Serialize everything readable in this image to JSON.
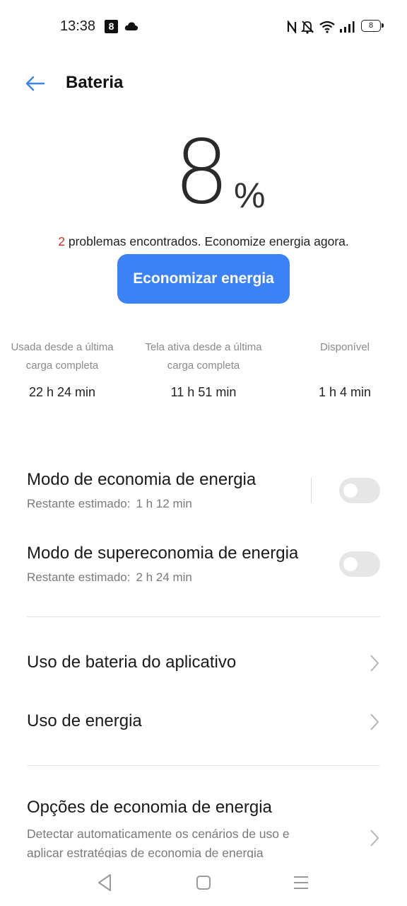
{
  "status_bar": {
    "time": "13:38",
    "badge": "8",
    "battery": "8",
    "icons": [
      "cloud-icon",
      "nfc-icon",
      "bell-off-icon",
      "wifi-icon",
      "signal-icon",
      "battery-icon"
    ]
  },
  "header": {
    "title": "Bateria",
    "back_icon": "arrow-left-icon",
    "accent": "#3b82f6"
  },
  "battery": {
    "percent": "8",
    "percent_sign": "%",
    "problems_count": "2",
    "problems_text": " problemas encontrados. Economize energia agora.",
    "save_button": "Economizar energia"
  },
  "stats": [
    {
      "label_line1": "Usada desde a última",
      "label_line2": "carga completa",
      "value": "22 h 24 min"
    },
    {
      "label_line1": "Tela ativa desde a última",
      "label_line2": "carga completa",
      "value": "11 h 51 min"
    },
    {
      "label_line1": "Disponível",
      "label_line2": "",
      "value": "1 h 4 min"
    }
  ],
  "modes": [
    {
      "title": "Modo de economia de energia",
      "sub_label": "Restante estimado:",
      "sub_value": "1 h 12 min",
      "enabled": false
    },
    {
      "title": "Modo de supereconomia de energia",
      "sub_label": "Restante estimado:",
      "sub_value": "2 h 24 min",
      "enabled": false
    }
  ],
  "nav_items": [
    {
      "title": "Uso de bateria do aplicativo"
    },
    {
      "title": "Uso de energia"
    }
  ],
  "options": {
    "title": "Opções de economia de energia",
    "description": "Detectar automaticamente os cenários de uso e aplicar estratégias de economia de energia"
  },
  "colors": {
    "problems_count": "#d93025",
    "toggle_off": "#e6e6e6"
  }
}
